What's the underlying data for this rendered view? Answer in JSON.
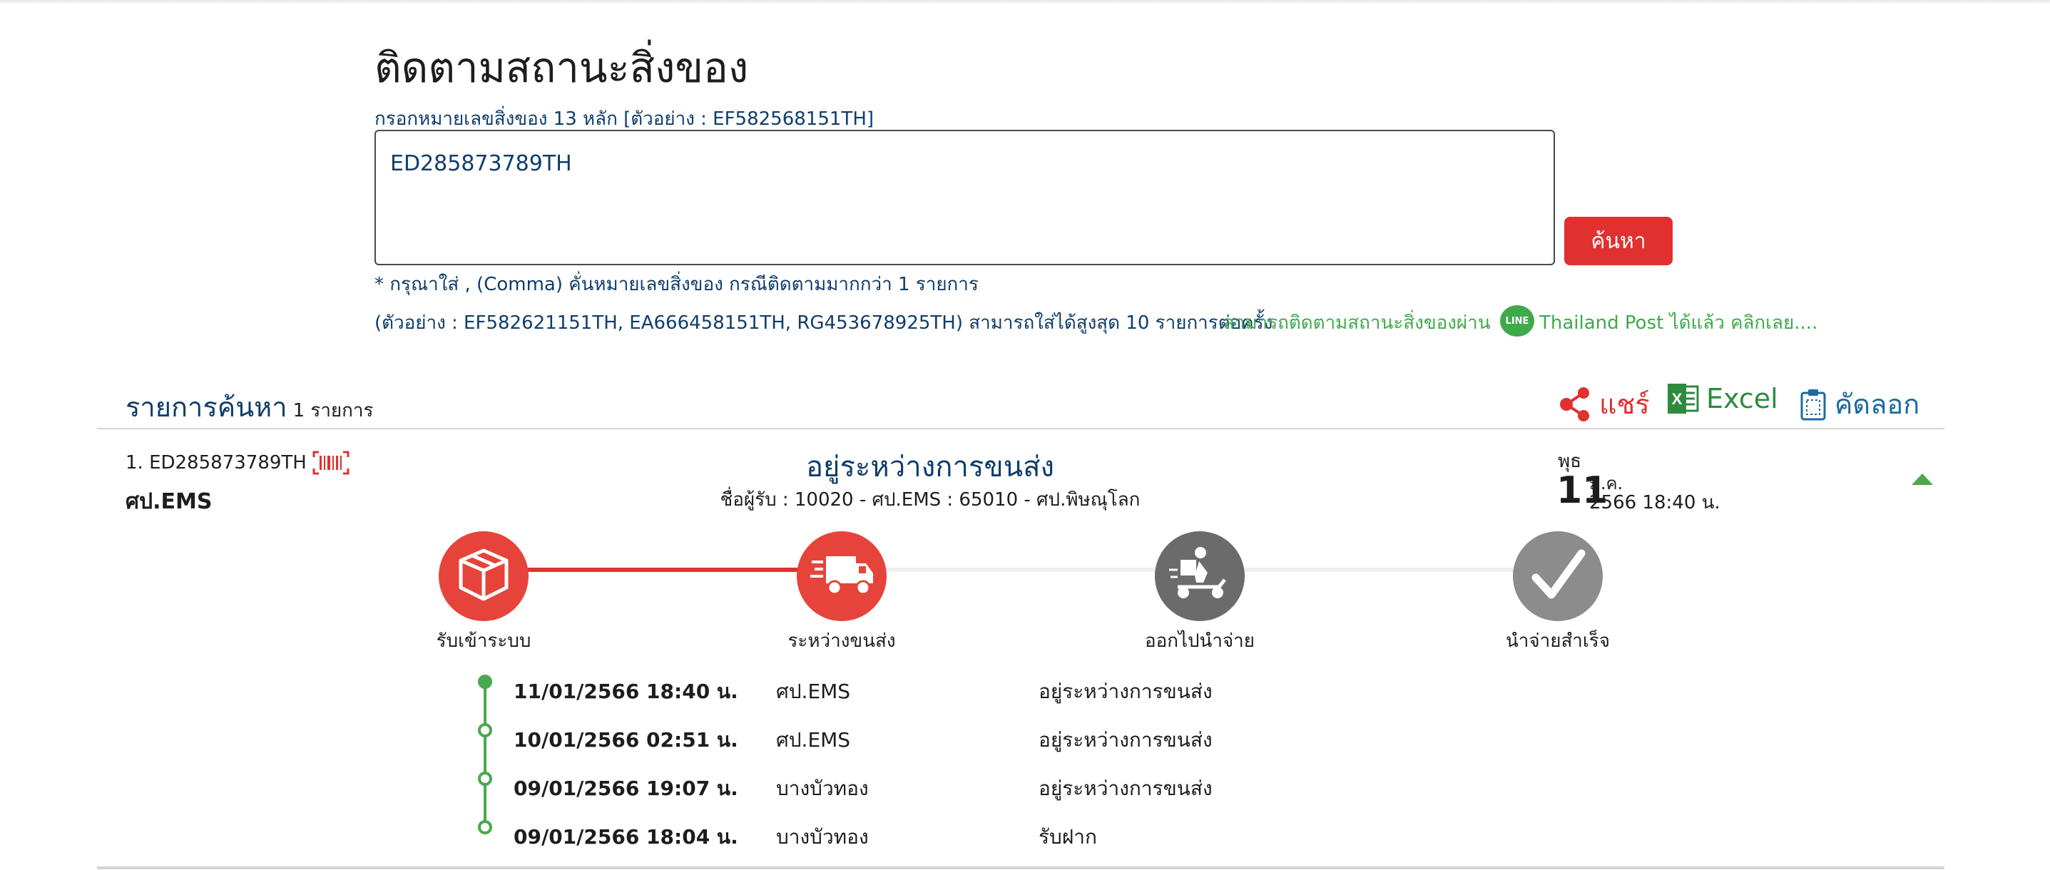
{
  "page": {
    "title": "ติดตามสถานะสิ่งของ",
    "hint": "กรอกหมายเลขสิ่งของ 13 หลัก [ตัวอย่าง : EF582568151TH]",
    "input_value": "ED285873789TH",
    "search_label": "ค้นหา",
    "note_comma": "* กรุณาใส่ , (Comma) คั่นหมายเลขสิ่งของ กรณีติดตามมากกว่า 1 รายการ",
    "note_example": "(ตัวอย่าง : EF582621151TH, EA666458151TH, RG453678925TH) สามารถใส่ได้สูงสุด 10 รายการต่อครั้ง",
    "line_text1": "สามารถติดตามสถานะสิ่งของผ่าน",
    "line_icon_text": "LINE",
    "line_text2": "Thailand Post ได้แล้ว คลิกเลย...."
  },
  "results": {
    "title": "รายการค้นหา",
    "count": "1 รายการ",
    "share_label": "แชร์",
    "excel_label": "Excel",
    "copy_label": "คัดลอก"
  },
  "item": {
    "id": "1. ED285873789TH",
    "office": "ศป.EMS",
    "status": "อยู่ระหว่างการขนส่ง",
    "route": "ชื่อผู้รับ : 10020 - ศป.EMS : 65010 - ศป.พิษณุโลก",
    "weekday": "พุธ",
    "day": "11",
    "month": "ม.ค.",
    "year_time": "2566  18:40 น."
  },
  "steps": [
    {
      "label": "รับเข้าระบบ",
      "icon": "box-icon",
      "state": "done"
    },
    {
      "label": "ระหว่างขนส่ง",
      "icon": "truck-icon",
      "state": "done"
    },
    {
      "label": "ออกไปนำจ่าย",
      "icon": "delivery-scooter-icon",
      "state": "pending"
    },
    {
      "label": "นำจ่ายสำเร็จ",
      "icon": "checkmark-icon",
      "state": "pending"
    }
  ],
  "timeline": [
    {
      "date": "11/01/2566 18:40 น.",
      "location": "ศป.EMS",
      "status": "อยู่ระหว่างการขนส่ง"
    },
    {
      "date": "10/01/2566 02:51 น.",
      "location": "ศป.EMS",
      "status": "อยู่ระหว่างการขนส่ง"
    },
    {
      "date": "09/01/2566 19:07 น.",
      "location": "บางบัวทอง",
      "status": "อยู่ระหว่างการขนส่ง"
    },
    {
      "date": "09/01/2566 18:04 น.",
      "location": "บางบัวทอง",
      "status": "รับฝาก"
    }
  ],
  "colors": {
    "accent_red": "#e03030",
    "navy": "#0f3d6b",
    "line_green": "#3eaa4a",
    "excel_green": "#2e8b3e",
    "pending_gray": "#6b6b6b",
    "done_gray": "#8c8c8c"
  }
}
